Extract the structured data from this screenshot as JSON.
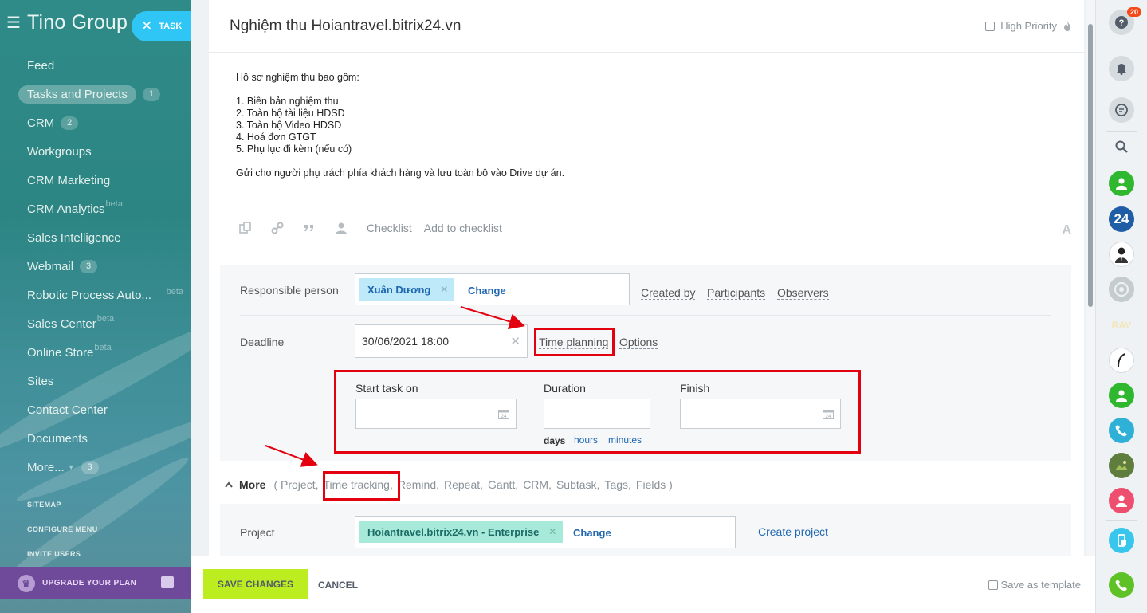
{
  "sidebar": {
    "logo": "Tino Group",
    "task_button": "TASK",
    "items": [
      {
        "label": "Feed"
      },
      {
        "label": "Tasks and Projects",
        "counter": "1",
        "active": true
      },
      {
        "label": "CRM",
        "counter": "2"
      },
      {
        "label": "Workgroups"
      },
      {
        "label": "CRM Marketing"
      },
      {
        "label": "CRM Analytics",
        "beta": "beta"
      },
      {
        "label": "Sales Intelligence"
      },
      {
        "label": "Webmail",
        "counter": "3"
      },
      {
        "label": "Robotic Process Auto...",
        "beta": "beta"
      },
      {
        "label": "Sales Center",
        "beta": "beta"
      },
      {
        "label": "Online Store",
        "beta": "beta"
      },
      {
        "label": "Sites"
      },
      {
        "label": "Contact Center"
      },
      {
        "label": "Documents"
      },
      {
        "label": "More...",
        "counter": "3"
      }
    ],
    "links": [
      "SITEMAP",
      "CONFIGURE MENU",
      "INVITE USERS"
    ],
    "upgrade": "UPGRADE YOUR PLAN"
  },
  "task": {
    "title": "Nghiệm thu Hoiantravel.bitrix24.vn",
    "high_priority": "High Priority",
    "description": [
      "Hồ sơ nghiệm thu bao gồm:",
      "",
      "1. Biên bản nghiệm thu",
      "2. Toàn bộ tài liệu HDSD",
      "3. Toàn bộ Video HDSD",
      "4. Hoá đơn GTGT",
      "5. Phụ lục đi kèm (nếu có)",
      "",
      "Gửi cho người phụ trách phía khách hàng và lưu toàn bộ vào Drive dự án."
    ],
    "toolbar": {
      "checklist": "Checklist",
      "add_to_checklist": "Add to checklist",
      "font": "A"
    }
  },
  "form": {
    "responsible_label": "Responsible person",
    "responsible_chip": "Xuân Dương",
    "change": "Change",
    "created_by": "Created by",
    "participants": "Participants",
    "observers": "Observers",
    "deadline_label": "Deadline",
    "deadline_value": "30/06/2021 18:00",
    "time_planning": "Time planning",
    "options": "Options",
    "start_label": "Start task on",
    "duration_label": "Duration",
    "finish_label": "Finish",
    "units": {
      "days": "days",
      "hours": "hours",
      "minutes": "minutes"
    }
  },
  "more": {
    "label": "More",
    "items": [
      "( Project,",
      "Time tracking,",
      "Remind,",
      "Repeat,",
      "Gantt,",
      "CRM,",
      "Subtask,",
      "Tags,",
      "Fields )"
    ]
  },
  "project": {
    "label": "Project",
    "chip": "Hoiantravel.bitrix24.vn - Enterprise",
    "change": "Change",
    "create": "Create project"
  },
  "footer": {
    "save": "SAVE CHANGES",
    "cancel": "CANCEL",
    "save_template": "Save as template"
  },
  "rail": {
    "badge": "20",
    "logo_24": "24",
    "rav_text": "RAV"
  },
  "colors": {
    "accent": "#2067b0",
    "save": "#bbed21",
    "annotation": "#e3000f",
    "chip": "#bde9f8",
    "project_chip": "#a8ead9"
  }
}
